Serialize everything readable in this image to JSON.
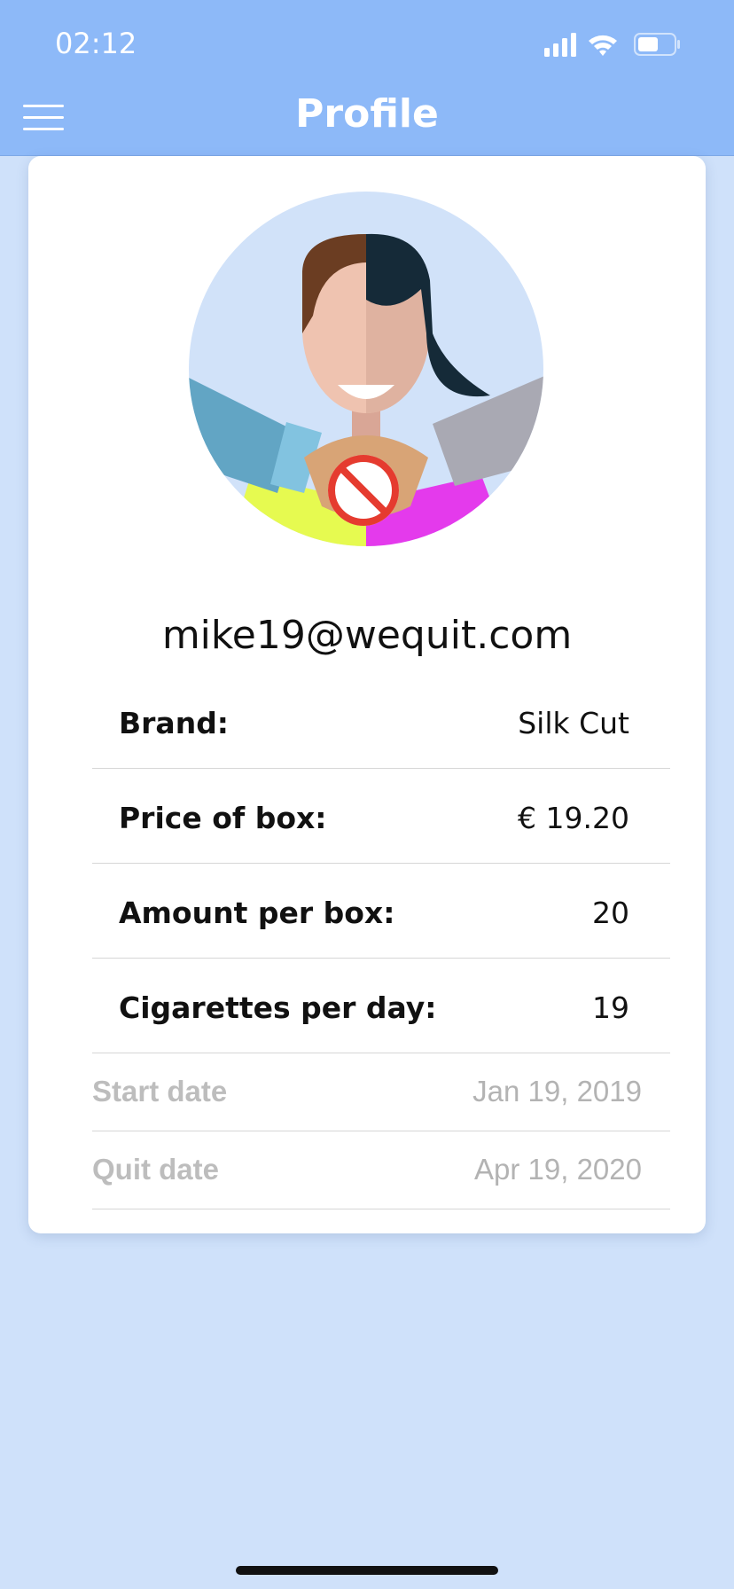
{
  "status_bar": {
    "time": "02:12"
  },
  "header": {
    "title": "Profile",
    "menu_icon": "hamburger-menu-icon"
  },
  "colors": {
    "header_bg": "#8db9f8",
    "page_bg": "#cfe1fa",
    "card_bg": "#ffffff",
    "disabled_text": "#bdbdbd"
  },
  "profile": {
    "avatar_icon": "quit-smoking-handshake-avatar",
    "email": "mike19@wequit.com",
    "fields": [
      {
        "label": "Brand:",
        "value": "Silk Cut"
      },
      {
        "label": "Price of box:",
        "value": "€ 19.20"
      },
      {
        "label": "Amount per box:",
        "value": "20"
      },
      {
        "label": "Cigarettes per day:",
        "value": "19"
      }
    ],
    "dates": [
      {
        "label": "Start date",
        "value": "Jan 19, 2019"
      },
      {
        "label": "Quit date",
        "value": "Apr 19, 2020"
      }
    ]
  }
}
